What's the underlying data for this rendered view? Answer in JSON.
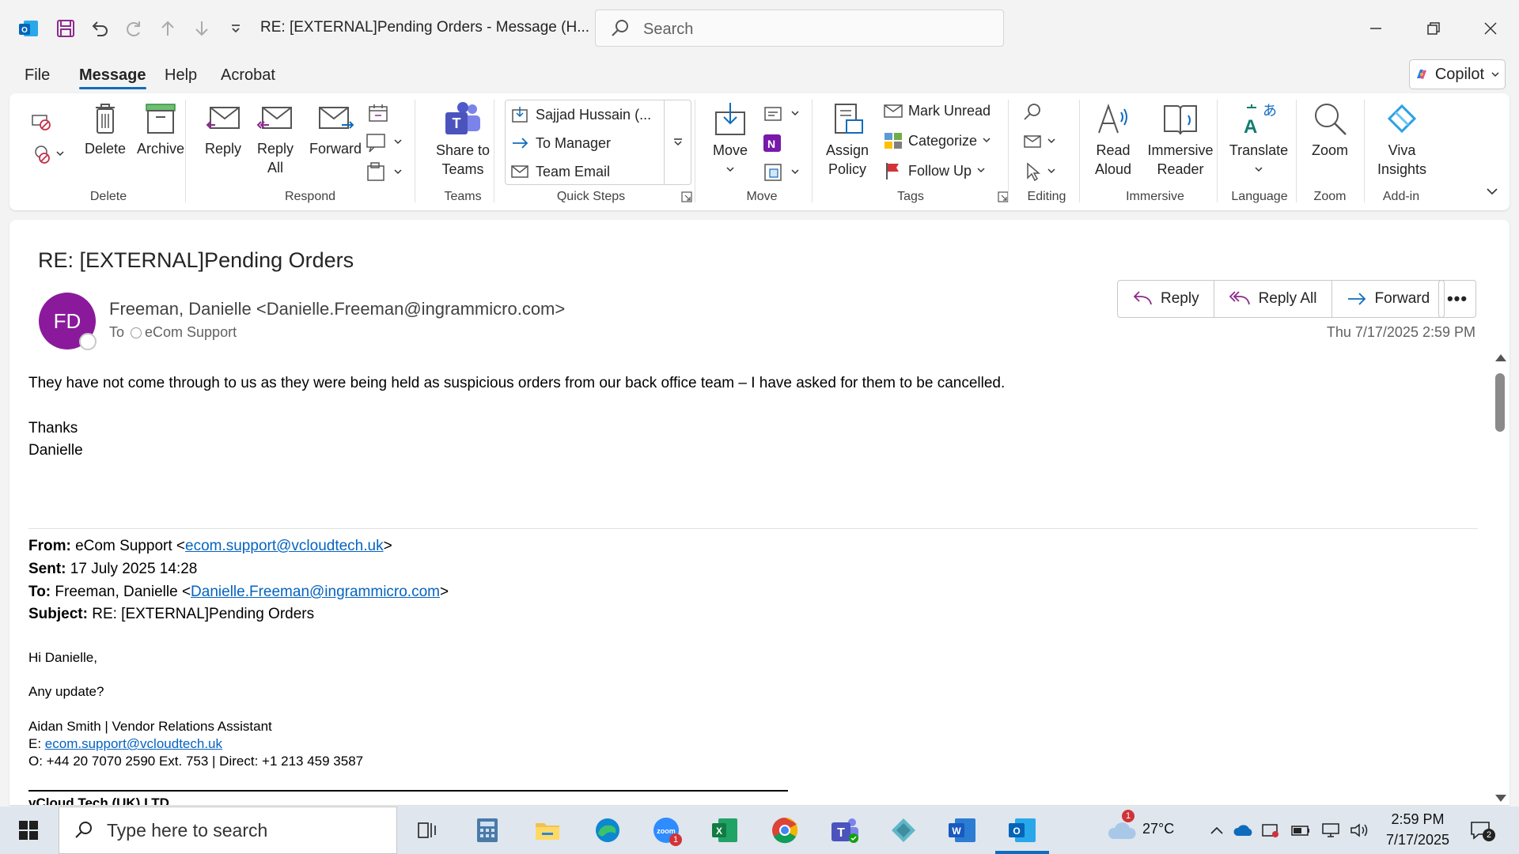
{
  "window": {
    "title": "RE: [EXTERNAL]Pending Orders  -  Message (H...",
    "search_placeholder": "Search"
  },
  "menu": {
    "tabs": [
      "File",
      "Message",
      "Help",
      "Acrobat"
    ],
    "active_tab": "Message",
    "copilot_label": "Copilot"
  },
  "ribbon": {
    "groups": {
      "delete": "Delete",
      "respond": "Respond",
      "teams": "Teams",
      "quick_steps": "Quick Steps",
      "move": "Move",
      "tags": "Tags",
      "editing": "Editing",
      "immersive": "Immersive",
      "language": "Language",
      "zoom": "Zoom",
      "addin": "Add-in"
    },
    "buttons": {
      "delete": "Delete",
      "archive": "Archive",
      "reply": "Reply",
      "reply_all_1": "Reply",
      "reply_all_2": "All",
      "forward": "Forward",
      "share_teams_1": "Share to",
      "share_teams_2": "Teams",
      "move": "Move",
      "assign_policy_1": "Assign",
      "assign_policy_2": "Policy",
      "mark_unread": "Mark Unread",
      "categorize": "Categorize",
      "follow_up": "Follow Up",
      "read_aloud_1": "Read",
      "read_aloud_2": "Aloud",
      "immersive_reader_1": "Immersive",
      "immersive_reader_2": "Reader",
      "translate": "Translate",
      "zoom": "Zoom",
      "viva_1": "Viva",
      "viva_2": "Insights"
    },
    "quick_steps": [
      "Sajjad Hussain (...",
      "To Manager",
      "Team Email"
    ]
  },
  "message": {
    "subject": "RE: [EXTERNAL]Pending Orders",
    "avatar_initials": "FD",
    "sender": "Freeman, Danielle <Danielle.Freeman@ingrammicro.com>",
    "to_label": "To",
    "to_recipient": "eCom Support",
    "date": "Thu 7/17/2025 2:59 PM",
    "actions": {
      "reply": "Reply",
      "reply_all": "Reply All",
      "forward": "Forward",
      "more": "•••"
    },
    "body": {
      "line1": "They have not come through to us as they were being held as suspicious orders from our back office team – I have asked for them to be cancelled.",
      "thanks": "Thanks",
      "name": "Danielle"
    },
    "quoted": {
      "from_label": "From:",
      "from_name": "eCom Support <",
      "from_email": "ecom.support@vcloudtech.uk",
      "from_end": ">",
      "sent_label": "Sent:",
      "sent_value": "17 July 2025 14:28",
      "to_label": "To:",
      "to_name": "Freeman, Danielle <",
      "to_email": "Danielle.Freeman@ingrammicro.com",
      "to_end": ">",
      "subject_label": "Subject:",
      "subject_value": "RE: [EXTERNAL]Pending Orders",
      "greeting": "Hi Danielle,",
      "question": "Any update?",
      "sig_name": "Aidan Smith | Vendor Relations Assistant",
      "sig_email_label": "E: ",
      "sig_email": "ecom.support@vcloudtech.uk",
      "sig_phone": "O:  +44 20 7070 2590 Ext. 753 | Direct: +1 213 459 3587",
      "company": "vCloud Tech (UK) LTD"
    }
  },
  "taskbar": {
    "search_placeholder": "Type here to search",
    "weather": "27°C",
    "weather_badge": "1",
    "zoom_badge": "1",
    "time": "2:59 PM",
    "date": "7/17/2025",
    "notification_count": "2"
  },
  "colors": {
    "accent": "#0f6cbd",
    "avatar": "#8a1a9b",
    "link": "#0563c1"
  }
}
